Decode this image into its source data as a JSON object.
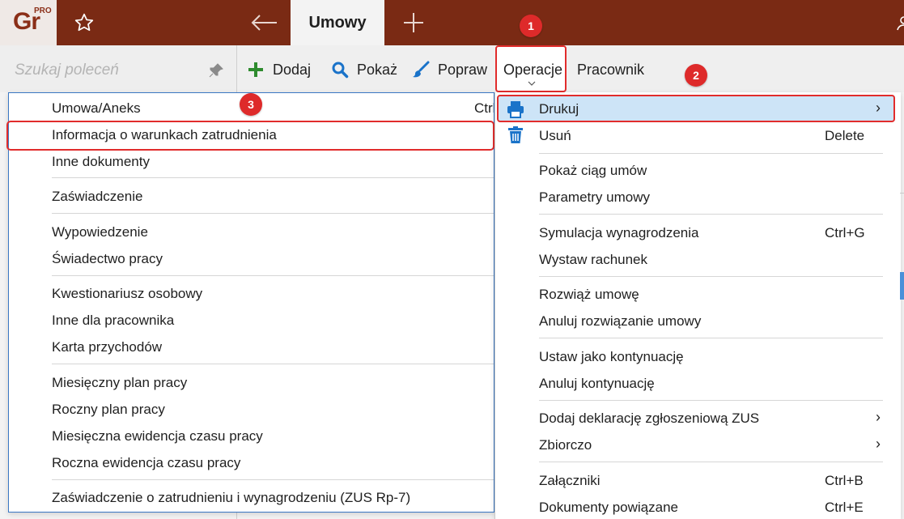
{
  "app": {
    "logo_text": "Gr",
    "logo_badge": "PRO",
    "active_tab": "Umowy"
  },
  "search": {
    "placeholder": "Szukaj poleceń"
  },
  "toolbar": {
    "add_label": "Dodaj",
    "show_label": "Pokaż",
    "edit_label": "Popraw",
    "operations_label": "Operacje",
    "employee_label": "Pracownik"
  },
  "badges": [
    "1",
    "2",
    "3"
  ],
  "print_submenu": {
    "items": [
      "Umowa/Aneks",
      "Informacja o warunkach zatrudnienia",
      "Inne dokumenty",
      "Zaświadczenie",
      "Wypowiedzenie",
      "Świadectwo pracy",
      "Kwestionariusz osobowy",
      "Inne dla pracownika",
      "Karta przychodów",
      "Miesięczny plan pracy",
      "Roczny plan pracy",
      "Miesięczna ewidencja czasu pracy",
      "Roczna ewidencja czasu pracy",
      "Zaświadczenie o zatrudnieniu i wynagrodzeniu (ZUS Rp-7)"
    ],
    "first_item_shortcut": "Ctrl"
  },
  "operations_menu": {
    "items": [
      {
        "label": "Drukuj",
        "shortcut": "",
        "submenu": true,
        "icon": "printer-icon"
      },
      {
        "label": "Usuń",
        "shortcut": "Delete",
        "submenu": false,
        "icon": "trash-icon"
      },
      {
        "label": "Pokaż ciąg umów",
        "shortcut": "",
        "submenu": false
      },
      {
        "label": "Parametry umowy",
        "shortcut": "",
        "submenu": false
      },
      {
        "label": "Symulacja wynagrodzenia",
        "shortcut": "Ctrl+G",
        "submenu": false
      },
      {
        "label": "Wystaw rachunek",
        "shortcut": "",
        "submenu": false
      },
      {
        "label": "Rozwiąż umowę",
        "shortcut": "",
        "submenu": false
      },
      {
        "label": "Anuluj rozwiązanie umowy",
        "shortcut": "",
        "submenu": false
      },
      {
        "label": "Ustaw jako kontynuację",
        "shortcut": "",
        "submenu": false
      },
      {
        "label": "Anuluj kontynuację",
        "shortcut": "",
        "submenu": false
      },
      {
        "label": "Dodaj deklarację zgłoszeniową ZUS",
        "shortcut": "",
        "submenu": true
      },
      {
        "label": "Zbiorczo",
        "shortcut": "",
        "submenu": true
      },
      {
        "label": "Załączniki",
        "shortcut": "Ctrl+B",
        "submenu": false
      },
      {
        "label": "Dokumenty powiązane",
        "shortcut": "Ctrl+E",
        "submenu": false
      }
    ]
  },
  "colors": {
    "titlebar": "#7a2a14",
    "highlight": "#cde4f7",
    "annotation": "#e12c2c",
    "accent_green": "#2e8b2e",
    "accent_blue": "#1a73c9"
  }
}
